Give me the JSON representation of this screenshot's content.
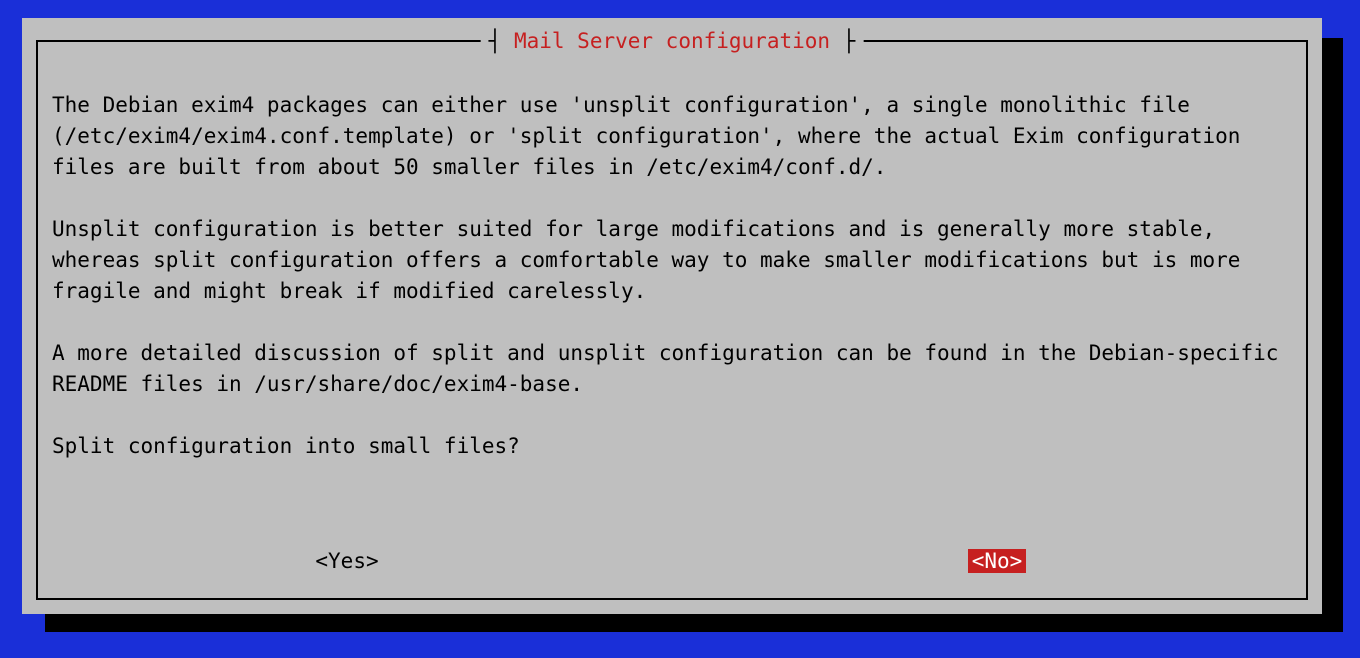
{
  "dialog": {
    "title": "Mail Server configuration",
    "paragraphs": [
      "The Debian exim4 packages can either use 'unsplit configuration', a single monolithic file (/etc/exim4/exim4.conf.template) or 'split configuration', where the actual Exim configuration files are built from about 50 smaller files in /etc/exim4/conf.d/.",
      "Unsplit configuration is better suited for large modifications and is generally more stable, whereas split configuration offers a comfortable way to make smaller modifications but is more fragile and might break if modified carelessly.",
      "A more detailed discussion of split and unsplit configuration can be found in the Debian-specific README files in /usr/share/doc/exim4-base.",
      "Split configuration into small files?"
    ],
    "buttons": {
      "yes": "<Yes>",
      "no": "<No>"
    },
    "selected": "no"
  }
}
